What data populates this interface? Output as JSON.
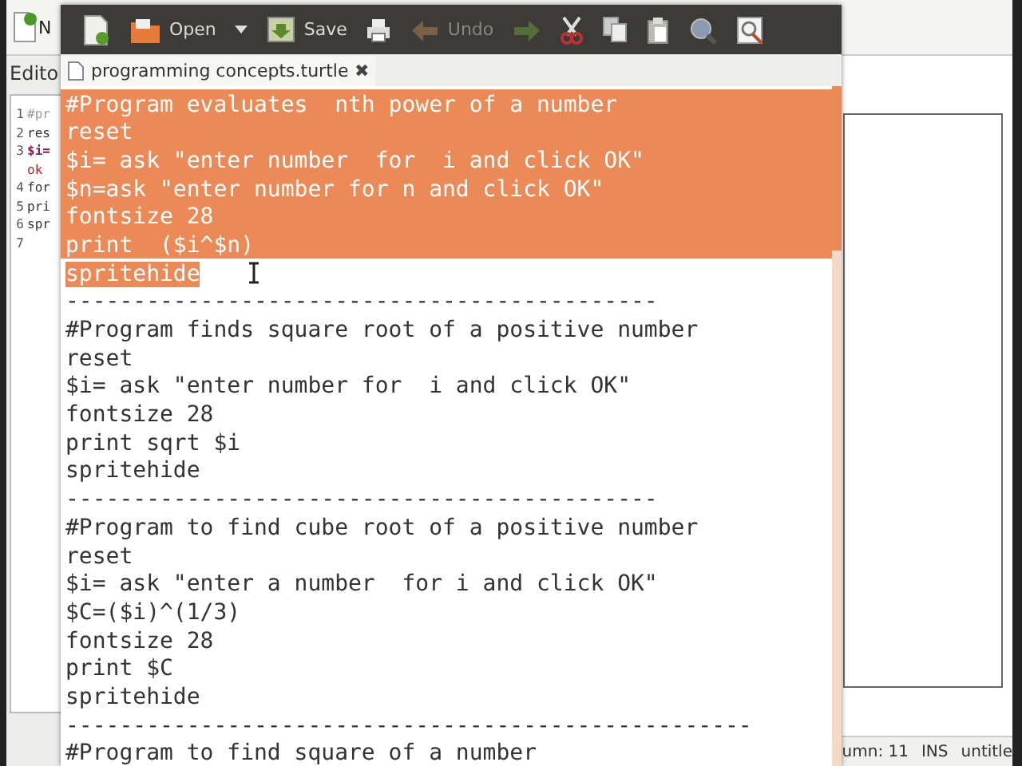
{
  "background_app": {
    "toolbar_label": "N",
    "panel_title": "Edito",
    "editor_lines": [
      {
        "number": "1",
        "text": "#pr",
        "kind": "comment"
      },
      {
        "number": "2",
        "text": "res",
        "kind": "plain"
      },
      {
        "number": "3",
        "text": "$i=",
        "kind": "variable"
      },
      {
        "text": "ok",
        "kind": "string"
      },
      {
        "number": "4",
        "text": "for",
        "kind": "plain"
      },
      {
        "number": "5",
        "text": "pri",
        "kind": "plain"
      },
      {
        "number": "6",
        "text": "spr",
        "kind": "plain"
      },
      {
        "number": "7"
      }
    ],
    "status_bar": {
      "position": "umn: 11",
      "mode": "INS",
      "file": "untitle"
    }
  },
  "editor_window": {
    "toolbar": [
      {
        "kind": "new",
        "disabled": false
      },
      {
        "kind": "open",
        "label": "Open",
        "disabled": false
      },
      {
        "kind": "dropdown",
        "disabled": false
      },
      {
        "kind": "save",
        "label": "Save",
        "disabled": false
      },
      {
        "kind": "print",
        "disabled": false
      },
      {
        "kind": "undo",
        "label": "Undo",
        "disabled": true
      },
      {
        "kind": "redo",
        "disabled": true
      },
      {
        "kind": "cut",
        "disabled": false
      },
      {
        "kind": "copy",
        "disabled": false
      },
      {
        "kind": "paste",
        "disabled": false
      },
      {
        "kind": "find",
        "disabled": false
      },
      {
        "kind": "replace",
        "disabled": false
      }
    ],
    "tab": {
      "title": "programming concepts.turtle",
      "close": "✖"
    },
    "lines": [
      {
        "text": "#Program evaluates  nth power of a number",
        "selected": true
      },
      {
        "text": "reset",
        "selected": true
      },
      {
        "text": "$i= ask \"enter number  for  i and click OK\"",
        "selected": true
      },
      {
        "text": "$n=ask \"enter number for n and click OK\"",
        "selected": true
      },
      {
        "text": "fontsize 28",
        "selected": true
      },
      {
        "text": "print  ($i^$n)",
        "selected": true
      },
      {
        "text": "spritehide",
        "selected": true
      },
      {
        "text": "--------------------------------------------",
        "selected": false
      },
      {
        "text": "#Program finds square root of a positive number",
        "selected": false
      },
      {
        "text": "reset",
        "selected": false
      },
      {
        "text": "$i= ask \"enter number for  i and click OK\"",
        "selected": false
      },
      {
        "text": "fontsize 28",
        "selected": false
      },
      {
        "text": "print sqrt $i",
        "selected": false
      },
      {
        "text": "spritehide",
        "selected": false
      },
      {
        "text": "--------------------------------------------",
        "selected": false
      },
      {
        "text": "#Program to find cube root of a positive number",
        "selected": false
      },
      {
        "text": "reset",
        "selected": false
      },
      {
        "text": "$i= ask \"enter a number  for i and click OK\"",
        "selected": false
      },
      {
        "text": "$C=($i)^(1/3)",
        "selected": false
      },
      {
        "text": "fontsize 28",
        "selected": false
      },
      {
        "text": "print $C",
        "selected": false
      },
      {
        "text": "spritehide",
        "selected": false
      },
      {
        "text": "---------------------------------------------------",
        "selected": false
      },
      {
        "text": "#Program to find square of a number",
        "selected": false
      }
    ]
  }
}
